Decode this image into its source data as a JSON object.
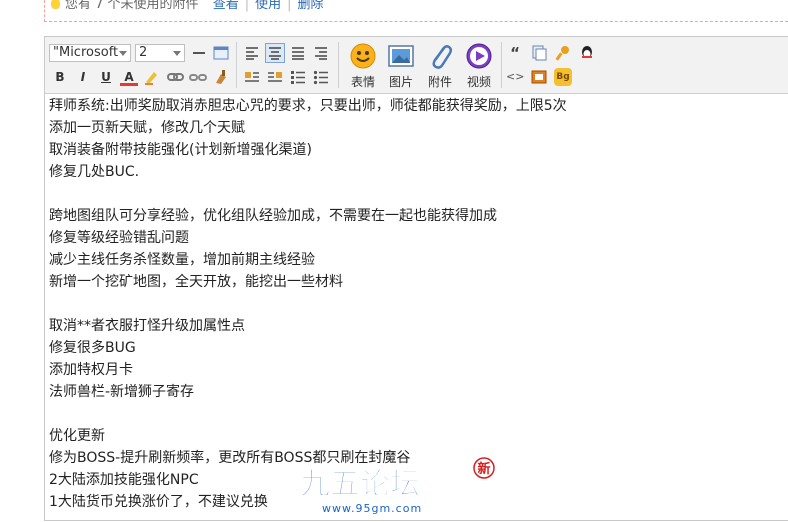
{
  "notice": {
    "text": "您有 7 个未使用的附件",
    "view": "查看",
    "use": "使用",
    "delete": "删除"
  },
  "toolbar": {
    "font_family": "\"Microsoft",
    "font_size": "2",
    "big_buttons": [
      {
        "label": "表情",
        "icon": "smiley-icon"
      },
      {
        "label": "图片",
        "icon": "image-icon"
      },
      {
        "label": "附件",
        "icon": "paperclip-icon"
      },
      {
        "label": "视频",
        "icon": "video-play-icon"
      }
    ],
    "small_labels": {
      "bold": "B",
      "italic": "I",
      "underline": "U",
      "color": "A",
      "quote": "“",
      "code": "<>",
      "bg": "Bg"
    }
  },
  "content": {
    "lines": [
      "拜师系统:出师奖励取消赤胆忠心咒的要求，只要出师，师徒都能获得奖励，上限5次",
      "添加一页新天赋，修改几个天赋",
      "取消装备附带技能强化(计划新增强化渠道)",
      "修复几处BUC.",
      "",
      "跨地图组队可分享经验，优化组队经验加成，不需要在一起也能获得加成",
      "修复等级经验错乱问题",
      "减少主线任务杀怪数量，增加前期主线经验",
      "新增一个挖矿地图，全天开放，能挖出一些材料",
      "",
      "取消**者衣服打怪升级加属性点",
      "修复很多BUG",
      "添加特权月卡",
      "法师兽栏-新增狮子寄存",
      "",
      "优化更新",
      "修为BOSS-提升刷新频率，更改所有BOSS都只刷在封魔谷",
      "2大陆添加技能强化NPC",
      "1大陆货币兑换涨价了，不建议兑换"
    ]
  },
  "watermark": {
    "title": "九五论坛",
    "url": "www.95gm.com",
    "badge": "新"
  },
  "colors": {
    "link": "#2a6ab8",
    "toolbar_bg": "#f2f2f2",
    "notice_border": "#f3a49a",
    "watermark_blue": "#1b63c9"
  }
}
